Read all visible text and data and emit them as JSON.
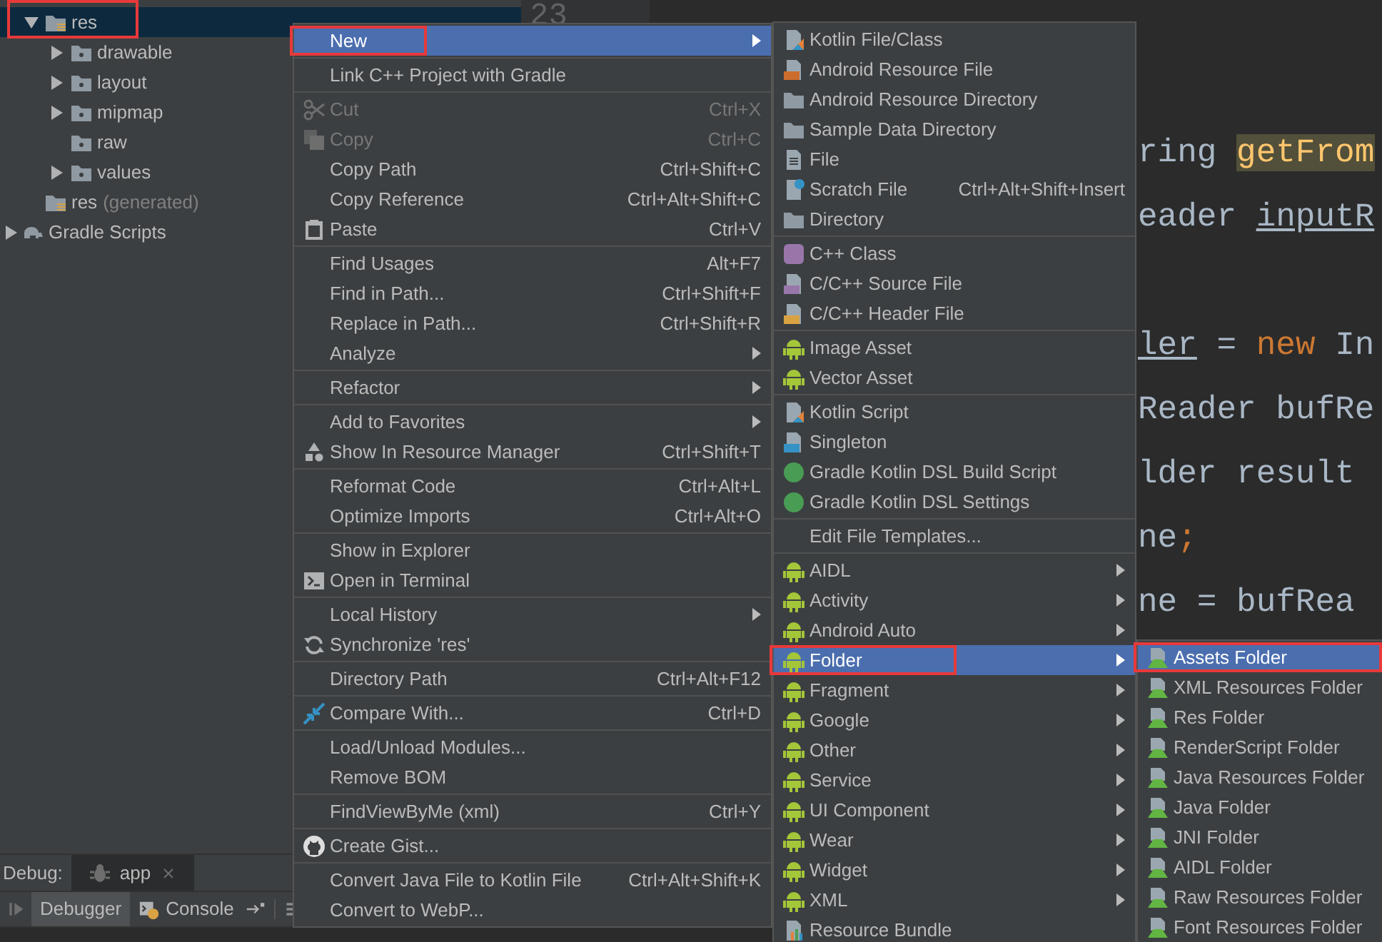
{
  "project_tree": {
    "annotation_frame": true,
    "module_items": [
      {
        "label": "res",
        "expanded": true,
        "selected": true,
        "children": [
          {
            "label": "drawable",
            "expanded": false,
            "selected": false
          },
          {
            "label": "layout",
            "expanded": false,
            "selected": false
          },
          {
            "label": "mipmap",
            "expanded": false,
            "selected": false
          },
          {
            "label": "raw",
            "selected": false
          },
          {
            "label": "values",
            "expanded": false,
            "selected": false
          }
        ]
      },
      {
        "label": "res",
        "note": "(generated)",
        "selected": false
      }
    ],
    "root_items": [
      {
        "label": "Gradle Scripts",
        "expanded": false,
        "selected": false
      }
    ]
  },
  "editor": {
    "line_number": "23",
    "lines": [
      {
        "gap_before": false,
        "segments": [
          {
            "text": "ring ",
            "kind": "plain"
          },
          {
            "text": "getFrom",
            "kind": "highlighted"
          }
        ]
      },
      {
        "gap_before": false,
        "segments": [
          {
            "text": "eader ",
            "kind": "plain"
          },
          {
            "text": "inputR",
            "kind": "underlined"
          }
        ]
      },
      {
        "gap_before": true,
        "segments": [
          {
            "text": "ler",
            "kind": "underlined"
          },
          {
            "text": " = ",
            "kind": "plain"
          },
          {
            "text": "new",
            "kind": "keyword"
          },
          {
            "text": " In",
            "kind": "plain"
          }
        ]
      },
      {
        "gap_before": false,
        "segments": [
          {
            "text": "Reader bufRe",
            "kind": "plain"
          }
        ]
      },
      {
        "gap_before": false,
        "segments": [
          {
            "text": "lder result",
            "kind": "plain"
          }
        ]
      },
      {
        "gap_before": false,
        "segments": [
          {
            "text": "ne",
            "kind": "plain"
          },
          {
            "text": ";",
            "kind": "keyword"
          }
        ]
      },
      {
        "gap_before": false,
        "segments": [
          {
            "text": "ne = bufRea",
            "kind": "plain"
          }
        ]
      }
    ]
  },
  "context_menu": {
    "annotation_frame": true,
    "groups": [
      [
        {
          "label": "New",
          "selected": true,
          "disabled": false,
          "submenu": true
        }
      ],
      [
        {
          "label": "Link C++ Project with Gradle",
          "selected": false,
          "disabled": false,
          "submenu": false
        }
      ],
      [
        {
          "label": "Cut",
          "shortcut": "Ctrl+X",
          "selected": false,
          "disabled": true,
          "submenu": false
        },
        {
          "label": "Copy",
          "shortcut": "Ctrl+C",
          "selected": false,
          "disabled": true,
          "submenu": false
        },
        {
          "label": "Copy Path",
          "shortcut": "Ctrl+Shift+C",
          "selected": false,
          "disabled": false,
          "submenu": false
        },
        {
          "label": "Copy Reference",
          "shortcut": "Ctrl+Alt+Shift+C",
          "selected": false,
          "disabled": false,
          "submenu": false
        },
        {
          "label": "Paste",
          "shortcut": "Ctrl+V",
          "selected": false,
          "disabled": false,
          "submenu": false
        }
      ],
      [
        {
          "label": "Find Usages",
          "shortcut": "Alt+F7",
          "selected": false,
          "disabled": false,
          "submenu": false
        },
        {
          "label": "Find in Path...",
          "shortcut": "Ctrl+Shift+F",
          "selected": false,
          "disabled": false,
          "submenu": false
        },
        {
          "label": "Replace in Path...",
          "shortcut": "Ctrl+Shift+R",
          "selected": false,
          "disabled": false,
          "submenu": false
        },
        {
          "label": "Analyze",
          "selected": false,
          "disabled": false,
          "submenu": true
        }
      ],
      [
        {
          "label": "Refactor",
          "selected": false,
          "disabled": false,
          "submenu": true
        }
      ],
      [
        {
          "label": "Add to Favorites",
          "selected": false,
          "disabled": false,
          "submenu": true
        },
        {
          "label": "Show In Resource Manager",
          "shortcut": "Ctrl+Shift+T",
          "selected": false,
          "disabled": false,
          "submenu": false
        }
      ],
      [
        {
          "label": "Reformat Code",
          "shortcut": "Ctrl+Alt+L",
          "selected": false,
          "disabled": false,
          "submenu": false
        },
        {
          "label": "Optimize Imports",
          "shortcut": "Ctrl+Alt+O",
          "selected": false,
          "disabled": false,
          "submenu": false
        }
      ],
      [
        {
          "label": "Show in Explorer",
          "selected": false,
          "disabled": false,
          "submenu": false
        },
        {
          "label": "Open in Terminal",
          "selected": false,
          "disabled": false,
          "submenu": false
        }
      ],
      [
        {
          "label": "Local History",
          "selected": false,
          "disabled": false,
          "submenu": true
        },
        {
          "label": "Synchronize 'res'",
          "selected": false,
          "disabled": false,
          "submenu": false
        }
      ],
      [
        {
          "label": "Directory Path",
          "shortcut": "Ctrl+Alt+F12",
          "selected": false,
          "disabled": false,
          "submenu": false
        }
      ],
      [
        {
          "label": "Compare With...",
          "shortcut": "Ctrl+D",
          "selected": false,
          "disabled": false,
          "submenu": false
        }
      ],
      [
        {
          "label": "Load/Unload Modules...",
          "selected": false,
          "disabled": false,
          "submenu": false
        },
        {
          "label": "Remove BOM",
          "selected": false,
          "disabled": false,
          "submenu": false
        }
      ],
      [
        {
          "label": "FindViewByMe (xml)",
          "shortcut": "Ctrl+Y",
          "selected": false,
          "disabled": false,
          "submenu": false
        }
      ],
      [
        {
          "label": "Create Gist...",
          "selected": false,
          "disabled": false,
          "submenu": false
        }
      ],
      [
        {
          "label": "Convert Java File to Kotlin File",
          "shortcut": "Ctrl+Alt+Shift+K",
          "selected": false,
          "disabled": false,
          "submenu": false
        },
        {
          "label": "Convert to WebP...",
          "selected": false,
          "disabled": false,
          "submenu": false
        }
      ]
    ]
  },
  "new_submenu": {
    "annotation_frame": true,
    "groups": [
      [
        {
          "label": "Kotlin File/Class",
          "selected": false,
          "submenu": false
        },
        {
          "label": "Android Resource File",
          "selected": false,
          "submenu": false
        },
        {
          "label": "Android Resource Directory",
          "selected": false,
          "submenu": false
        },
        {
          "label": "Sample Data Directory",
          "selected": false,
          "submenu": false
        },
        {
          "label": "File",
          "selected": false,
          "submenu": false
        },
        {
          "label": "Scratch File",
          "shortcut": "Ctrl+Alt+Shift+Insert",
          "selected": false,
          "submenu": false
        },
        {
          "label": "Directory",
          "selected": false,
          "submenu": false
        }
      ],
      [
        {
          "label": "C++ Class",
          "selected": false,
          "submenu": false
        },
        {
          "label": "C/C++ Source File",
          "selected": false,
          "submenu": false
        },
        {
          "label": "C/C++ Header File",
          "selected": false,
          "submenu": false
        }
      ],
      [
        {
          "label": "Image Asset",
          "selected": false,
          "submenu": false
        },
        {
          "label": "Vector Asset",
          "selected": false,
          "submenu": false
        }
      ],
      [
        {
          "label": "Kotlin Script",
          "selected": false,
          "submenu": false
        },
        {
          "label": "Singleton",
          "selected": false,
          "submenu": false
        },
        {
          "label": "Gradle Kotlin DSL Build Script",
          "selected": false,
          "submenu": false
        },
        {
          "label": "Gradle Kotlin DSL Settings",
          "selected": false,
          "submenu": false
        }
      ],
      [
        {
          "label": "Edit File Templates...",
          "selected": false,
          "submenu": false
        }
      ],
      [
        {
          "label": "AIDL",
          "selected": false,
          "submenu": true
        },
        {
          "label": "Activity",
          "selected": false,
          "submenu": true
        },
        {
          "label": "Android Auto",
          "selected": false,
          "submenu": true
        },
        {
          "label": "Folder",
          "selected": true,
          "submenu": true
        },
        {
          "label": "Fragment",
          "selected": false,
          "submenu": true
        },
        {
          "label": "Google",
          "selected": false,
          "submenu": true
        },
        {
          "label": "Other",
          "selected": false,
          "submenu": true
        },
        {
          "label": "Service",
          "selected": false,
          "submenu": true
        },
        {
          "label": "UI Component",
          "selected": false,
          "submenu": true
        },
        {
          "label": "Wear",
          "selected": false,
          "submenu": true
        },
        {
          "label": "Widget",
          "selected": false,
          "submenu": true
        },
        {
          "label": "XML",
          "selected": false,
          "submenu": true
        },
        {
          "label": "Resource Bundle",
          "selected": false,
          "submenu": false
        }
      ]
    ]
  },
  "folder_submenu": {
    "annotation_frame": true,
    "groups": [
      [
        {
          "label": "Assets Folder",
          "selected": true,
          "submenu": false
        },
        {
          "label": "XML Resources Folder",
          "selected": false,
          "submenu": false
        },
        {
          "label": "Res Folder",
          "selected": false,
          "submenu": false
        },
        {
          "label": "RenderScript Folder",
          "selected": false,
          "submenu": false
        },
        {
          "label": "Java Resources Folder",
          "selected": false,
          "submenu": false
        },
        {
          "label": "Java Folder",
          "selected": false,
          "submenu": false
        },
        {
          "label": "JNI Folder",
          "selected": false,
          "submenu": false
        },
        {
          "label": "AIDL Folder",
          "selected": false,
          "submenu": false
        },
        {
          "label": "Raw Resources Folder",
          "selected": false,
          "submenu": false
        },
        {
          "label": "Font Resources Folder",
          "selected": false,
          "submenu": false
        }
      ]
    ]
  },
  "debug_panel": {
    "title": "Debug:",
    "session_tabs": [
      {
        "label": "app",
        "selected": true
      }
    ],
    "tool_tabs": [
      {
        "label": "Debugger",
        "selected": true
      },
      {
        "label": "Console",
        "selected": false
      }
    ]
  }
}
